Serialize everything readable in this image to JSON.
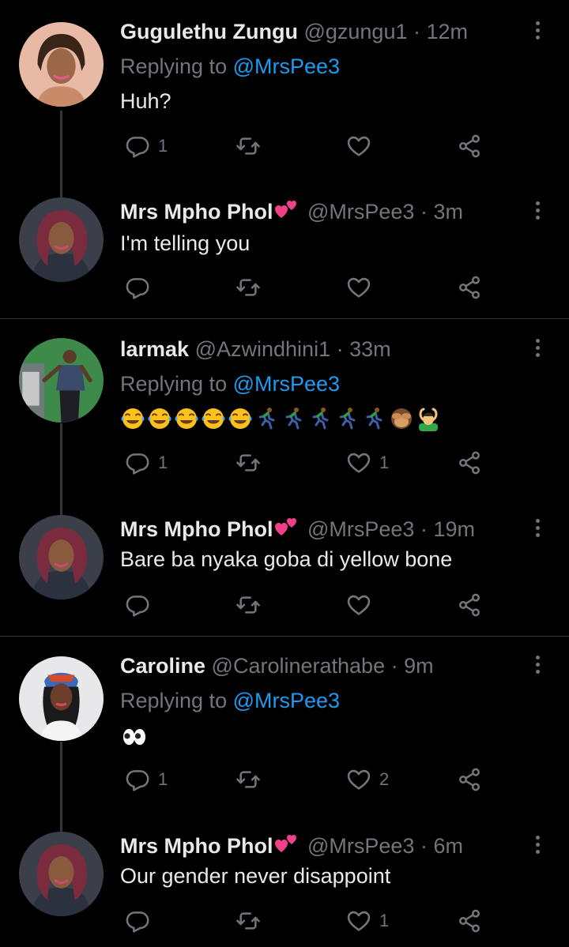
{
  "colors": {
    "background": "#000000",
    "text": "#e7e9ea",
    "muted": "#71767b",
    "accent": "#1d9bf0",
    "heart_emoji": "#f0408a"
  },
  "tweets": [
    {
      "name": "Gugulethu Zungu",
      "handle": "@gzungu1",
      "time": "· 12m",
      "replying_prefix": "Replying to",
      "replying_handle": "@MrsPee3",
      "text": "Huh?",
      "reply_count": "1",
      "retweet_count": "",
      "like_count": ""
    },
    {
      "name": "Mrs Mpho Phol",
      "name_emoji": "two-hearts",
      "handle": "@MrsPee3",
      "time": "· 3m",
      "text": "I'm telling you",
      "reply_count": "",
      "retweet_count": "",
      "like_count": ""
    },
    {
      "name": "larmak",
      "handle": "@Azwindhini1",
      "time": "· 33m",
      "replying_prefix": "Replying to",
      "replying_handle": "@MrsPee3",
      "emojis": [
        "tears-of-joy",
        "tears-of-joy",
        "tears-of-joy",
        "tears-of-joy",
        "tears-of-joy",
        "running-man",
        "running-man",
        "running-man",
        "running-man",
        "running-man",
        "see-no-evil-monkey",
        "person-gesturing-ok"
      ],
      "reply_count": "1",
      "retweet_count": "",
      "like_count": "1"
    },
    {
      "name": "Mrs Mpho Phol",
      "name_emoji": "two-hearts",
      "handle": "@MrsPee3",
      "time": "· 19m",
      "text": "Bare ba nyaka goba di yellow bone",
      "reply_count": "",
      "retweet_count": "",
      "like_count": ""
    },
    {
      "name": "Caroline",
      "handle": "@Carolinerathabe",
      "time": "· 9m",
      "replying_prefix": "Replying to",
      "replying_handle": "@MrsPee3",
      "emojis": [
        "eyes"
      ],
      "reply_count": "1",
      "retweet_count": "",
      "like_count": "2"
    },
    {
      "name": "Mrs Mpho Phol",
      "name_emoji": "two-hearts",
      "handle": "@MrsPee3",
      "time": "· 6m",
      "text": "Our gender never disappoint",
      "reply_count": "",
      "retweet_count": "",
      "like_count": "1"
    }
  ]
}
